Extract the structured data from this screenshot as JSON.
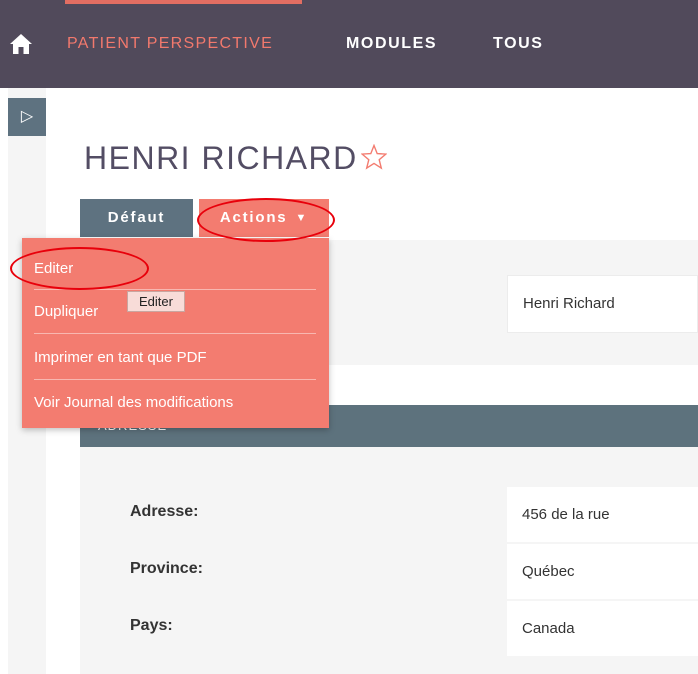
{
  "topbar": {
    "nav": {
      "brand": "PATIENT PERSPECTIVE",
      "modules": "MODULES",
      "all": "TOUS"
    }
  },
  "sidebar": {
    "toggle_icon": "▷"
  },
  "record": {
    "title": "HENRI RICHARD",
    "star_icon": "star-outline-icon",
    "tabs": {
      "default": "Défaut",
      "actions": "Actions"
    },
    "name_value": "Henri Richard"
  },
  "address": {
    "section_title": "ADRESSE",
    "fields": [
      {
        "label": "Adresse:",
        "value": "456 de la rue"
      },
      {
        "label": "Province:",
        "value": "Québec"
      },
      {
        "label": "Pays:",
        "value": "Canada"
      }
    ]
  },
  "actions_menu": {
    "items": [
      "Editer",
      "Dupliquer",
      "Imprimer en tant que PDF",
      "Voir Journal des modifications"
    ],
    "tooltip": "Editer"
  },
  "colors": {
    "topbar": "#514a5b",
    "accent": "#f37c70",
    "tab_default": "#5e7280",
    "annotation": "#e8000b"
  }
}
